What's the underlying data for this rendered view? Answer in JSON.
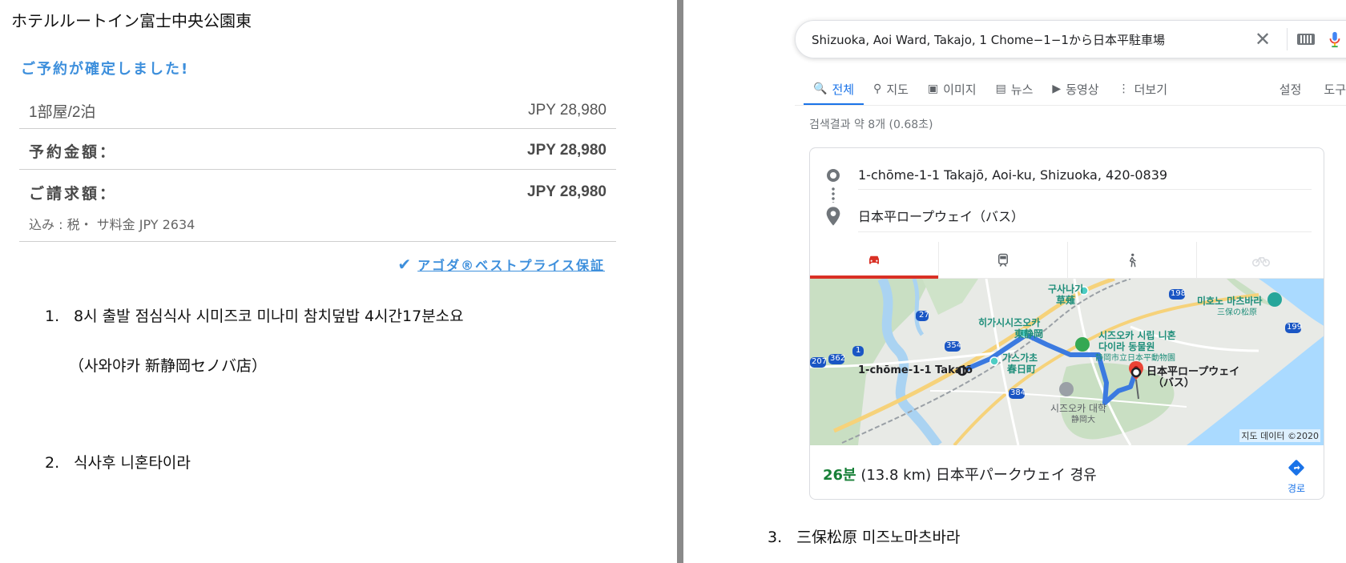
{
  "left": {
    "hotel_title": "ホテルルートイン富士中央公園東",
    "confirm_text": "ご予約が確定しました!",
    "rows": [
      {
        "label": "1部屋/2泊",
        "value": "JPY 28,980"
      },
      {
        "label": "予約金額：",
        "value": "JPY 28,980"
      },
      {
        "label": "ご請求額：",
        "value": "JPY 28,980"
      }
    ],
    "tax_note": "込み : 税・ サ料金 JPY 2634",
    "guarantee": "アゴダ®ベストプライス保証",
    "notes": [
      {
        "num": "1.",
        "text": "8시 출발 점심식사 시미즈코 미나미 참치덮밥  4시간17분소요"
      },
      {
        "num": "",
        "text": "（사와야카 新静岡セノバ店）"
      },
      {
        "num": "2.",
        "text": "식사후 니혼타이라"
      }
    ],
    "accent_color": "#3d8fdc"
  },
  "right": {
    "search_query": "Shizuoka, Aoi Ward, Takajo, 1 Chome−1−1から日本平駐車場",
    "tabs": [
      {
        "label": "전체",
        "icon": "search-icon",
        "active": true
      },
      {
        "label": "지도",
        "icon": "map-pin-icon",
        "active": false
      },
      {
        "label": "이미지",
        "icon": "image-icon",
        "active": false
      },
      {
        "label": "뉴스",
        "icon": "news-icon",
        "active": false
      },
      {
        "label": "동영상",
        "icon": "video-icon",
        "active": false
      },
      {
        "label": "더보기",
        "icon": "more-vert-icon",
        "active": false
      }
    ],
    "tabs_right": [
      "설정",
      "도구"
    ],
    "result_stats": "검색결과 약 8개 (0.68초)",
    "route_from": "1-chōme-1-1 Takajō, Aoi-ku, Shizuoka, 420-0839",
    "route_to": "日本平ロープウェイ（バス）",
    "modes": [
      "car-icon",
      "transit-icon",
      "walk-icon",
      "bike-icon"
    ],
    "map": {
      "labels": {
        "kusanagi": "구사나기",
        "kusanagi_jp": "草薙",
        "higashi": "히가시시즈오카",
        "higashi_jp": "東静岡",
        "city_zoo": "시즈오카 시립 니혼",
        "city_zoo2": "다이라 동물원",
        "city_zoo_jp": "静岡市立日本平動物園",
        "kasuga": "가스가초",
        "kasuga_jp": "春日町",
        "origin": "1-chōme-1-1 Takajō",
        "dest1": "日本平ロープウェイ",
        "dest2": "（バス）",
        "univ": "시즈오카 대학",
        "univ_jp": "静岡大",
        "miho": "미호노 마츠바라",
        "miho_jp": "三保の松原",
        "r27": "27",
        "r198": "198",
        "r199": "199",
        "r354": "354",
        "r362": "362",
        "r1": "1",
        "r207": "207",
        "r384": "384"
      },
      "credit": "지도 데이터 ©2020"
    },
    "duration": "26분",
    "summary_rest": " (13.8 km) 日本平パークウェイ 경유",
    "directions_label": "경로",
    "note3": {
      "num": "3.",
      "text": "三保松原 미즈노마츠바라"
    }
  }
}
